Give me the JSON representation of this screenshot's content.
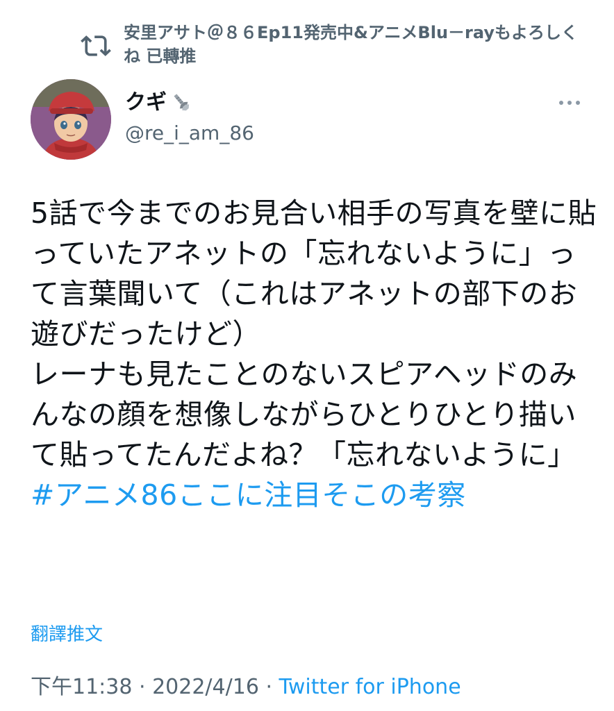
{
  "retweet": {
    "text": "安里アサト＠８６Ep11発売中&アニメBlu－rayもよろしくね 已轉推",
    "icon": "retweet-icon"
  },
  "author": {
    "display_name": "クギ",
    "name_emoji": "nut-and-bolt-icon",
    "handle": "@re_i_am_86",
    "avatar": "avatar-icon"
  },
  "tweet": {
    "text_lines": "5話で今までのお見合い相手の写真を壁に貼っていたアネットの「忘れないように」って言葉聞いて（これはアネットの部下のお遊びだったけど）\nレーナも見たことのないスピアヘッドのみんなの顔を想像しながらひとりひとり描いて貼ってたんだよね？「忘れないように」",
    "hashtag": "#アニメ86ここに注目そこの考察"
  },
  "translate_label": "翻譯推文",
  "meta": {
    "time": "下午11:38",
    "separator1": " · ",
    "date": "2022/4/16",
    "separator2": " · ",
    "client": "Twitter for iPhone"
  },
  "colors": {
    "accent": "#1d9bf0",
    "muted": "#536471",
    "text": "#0f1419"
  }
}
